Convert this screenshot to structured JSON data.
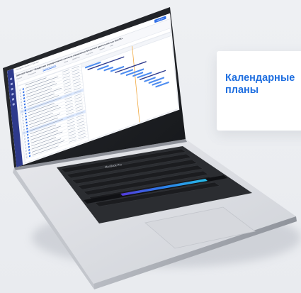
{
  "card": {
    "line1": "Календарные",
    "line2": "планы"
  },
  "keyboard": {
    "brand": "MacBook Pro"
  },
  "app": {
    "title": "ЗОН-007 Проект «Внедрение корпоративной системы управления проектной деятельностью ЗОСТЕ»",
    "crumb": "Портфели и проекты / ЗОН-007",
    "button": "Действия",
    "tabs": [
      "Паспорт",
      "Показатели",
      "Календарный план",
      "Риски",
      "Документы",
      "Участники",
      "Бюджет",
      "Ещё"
    ]
  },
  "colors": {
    "accent": "#1f6fe0",
    "sidebar": "#2e3a8c",
    "bar": "#4f8df0",
    "today": "#f0a63b"
  }
}
